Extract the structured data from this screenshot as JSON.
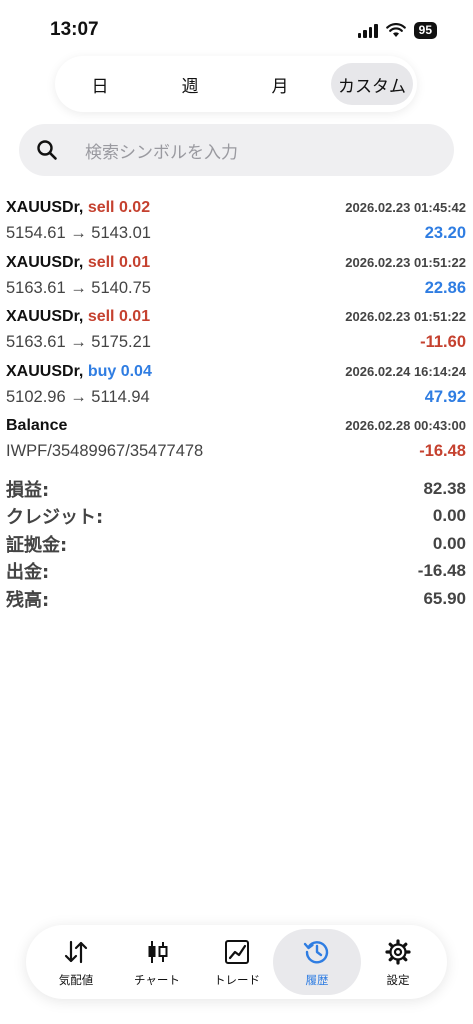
{
  "status": {
    "time": "13:07",
    "battery": "95"
  },
  "period_tabs": [
    {
      "label": "日"
    },
    {
      "label": "週"
    },
    {
      "label": "月"
    },
    {
      "label": "カスタム",
      "active": true
    }
  ],
  "search": {
    "placeholder": "検索シンボルを入力"
  },
  "trades": [
    {
      "symbol": "XAUUSDr,",
      "side": "sell 0.02",
      "time": "2026.02.23 01:45:42",
      "prices": "5154.61 → 5143.01",
      "profit": "23.20"
    },
    {
      "symbol": "XAUUSDr,",
      "side": "sell 0.01",
      "time": "2026.02.23 01:51:22",
      "prices": "5163.61 → 5140.75",
      "profit": "22.86"
    },
    {
      "symbol": "XAUUSDr,",
      "side": "sell 0.01",
      "time": "2026.02.23 01:51:22",
      "prices": "5163.61 → 5175.21",
      "profit": "-11.60"
    },
    {
      "symbol": "XAUUSDr,",
      "side": "buy 0.04",
      "time": "2026.02.24 16:14:24",
      "prices": "5102.96 → 5114.94",
      "profit": "47.92"
    },
    {
      "symbol": "Balance",
      "side": "",
      "time": "2026.02.28 00:43:00",
      "prices": "IWPF/35489967/35477478",
      "profit": "-16.48"
    }
  ],
  "summary": [
    {
      "label": "損益:",
      "value": "82.38"
    },
    {
      "label": "クレジット:",
      "value": "0.00"
    },
    {
      "label": "証拠金:",
      "value": "0.00"
    },
    {
      "label": "出金:",
      "value": "-16.48"
    },
    {
      "label": "残高:",
      "value": "65.90"
    }
  ],
  "nav": [
    {
      "label": "気配値",
      "icon": "quotes-arrows-icon"
    },
    {
      "label": "チャート",
      "icon": "candlestick-icon"
    },
    {
      "label": "トレード",
      "icon": "trade-chart-icon"
    },
    {
      "label": "履歴",
      "icon": "history-clock-icon",
      "active": true
    },
    {
      "label": "設定",
      "icon": "gear-icon"
    }
  ],
  "colors": {
    "loss": "#c5412f",
    "profit": "#2f7de2",
    "active_nav": "#2f7de2"
  }
}
